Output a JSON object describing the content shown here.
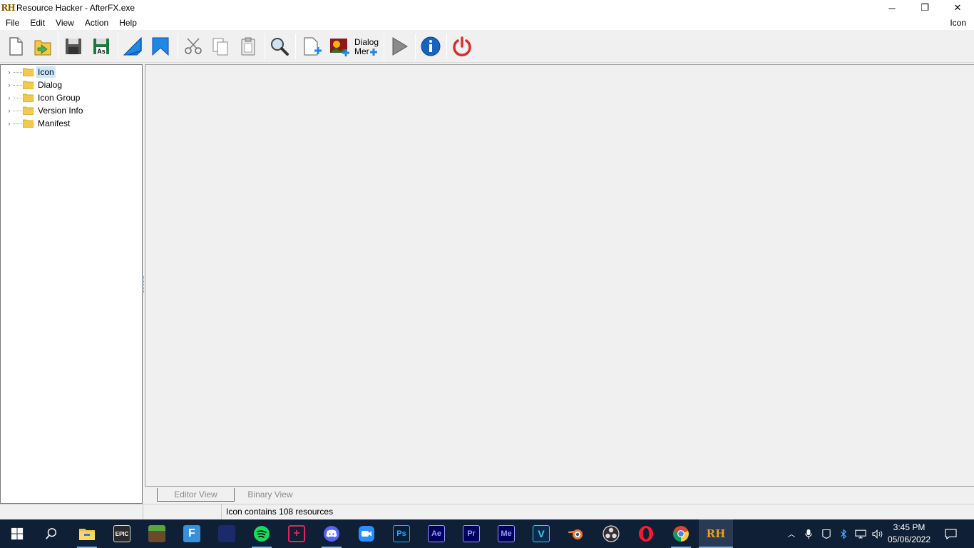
{
  "window": {
    "title": "Resource Hacker - AfterFX.exe",
    "app_icon": "RH",
    "controls": {
      "minimize": "─",
      "restore": "❐",
      "close": "✕"
    }
  },
  "menubar": {
    "items": [
      "File",
      "Edit",
      "View",
      "Action",
      "Help"
    ],
    "right_label": "Icon"
  },
  "toolbar": {
    "buttons": [
      "new-file-icon",
      "open-file-icon",
      "save-icon",
      "save-as-icon",
      "compile-icon",
      "bookmark-icon",
      "cut-icon",
      "copy-icon",
      "paste-icon",
      "find-icon",
      "add-resource-icon",
      "add-image-icon",
      "add-dialog-menu-icon",
      "run-icon",
      "info-icon",
      "exit-icon"
    ],
    "save_as_label": "As",
    "dialog_menu_label_1": "Dialog",
    "dialog_menu_label_2": "Mer"
  },
  "tree": {
    "items": [
      {
        "label": "Icon",
        "selected": true
      },
      {
        "label": "Dialog",
        "selected": false
      },
      {
        "label": "Icon Group",
        "selected": false
      },
      {
        "label": "Version Info",
        "selected": false
      },
      {
        "label": "Manifest",
        "selected": false
      }
    ]
  },
  "tabs": {
    "editor_view": "Editor View",
    "binary_view": "Binary View"
  },
  "status": {
    "message": "Icon contains 108 resources"
  },
  "taskbar": {
    "apps": [
      "windows-start-icon",
      "search-icon",
      "file-explorer-icon",
      "epic-games-icon",
      "minecraft-icon",
      "f-app-icon",
      "game-icon",
      "spotify-icon",
      "app-plus-icon",
      "discord-icon",
      "zoom-icon",
      "photoshop-icon",
      "after-effects-icon",
      "premiere-icon",
      "media-encoder-icon",
      "vegas-icon",
      "blender-icon",
      "obs-icon",
      "opera-icon",
      "chrome-icon",
      "resource-hacker-icon"
    ],
    "labels": {
      "epic": "EPIC",
      "ps": "Ps",
      "ae": "Ae",
      "pr": "Pr",
      "me": "Me",
      "v": "V",
      "rh": "RH",
      "f": "F"
    },
    "time": "3:45 PM",
    "date": "05/06/2022",
    "colors": {
      "taskbar_bg": "#0f1f35",
      "accent": "#76b9ed",
      "selection": "#cce8ff"
    }
  }
}
